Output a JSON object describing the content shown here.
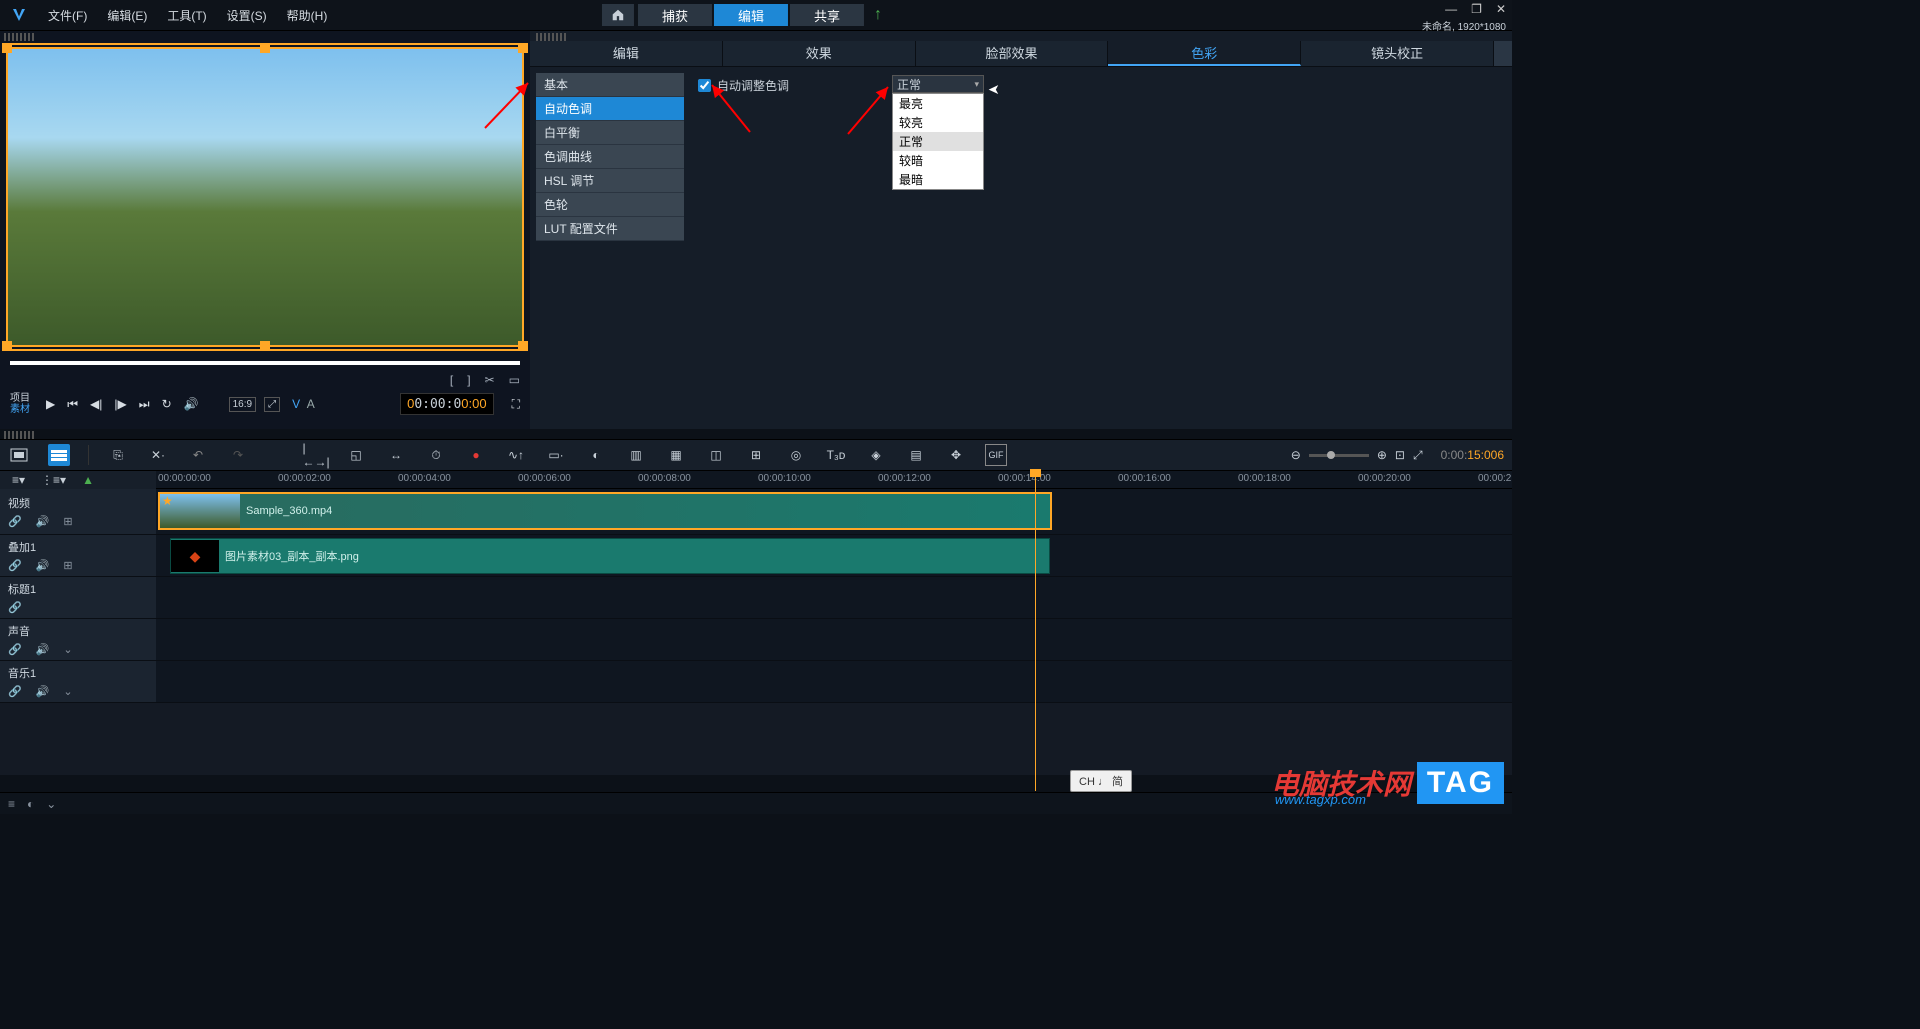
{
  "titlebar": {
    "menus": [
      "文件(F)",
      "编辑(E)",
      "工具(T)",
      "设置(S)",
      "帮助(H)"
    ],
    "tabs": {
      "capture": "捕获",
      "edit": "编辑",
      "share": "共享"
    },
    "project": "未命名, 1920*1080"
  },
  "playback": {
    "project_label": "项目",
    "clip_label": "素材",
    "aspect": "16:9",
    "va": "V A",
    "timecode": "00:00:00:00"
  },
  "editor": {
    "tabs": {
      "edit": "编辑",
      "effect": "效果",
      "face": "脸部效果",
      "color": "色彩",
      "lens": "镜头校正"
    },
    "sidelist": [
      "基本",
      "自动色调",
      "白平衡",
      "色调曲线",
      "HSL 调节",
      "色轮",
      "LUT 配置文件"
    ],
    "auto_adjust_label": "自动调整色调",
    "dropdown": {
      "selected": "正常",
      "options": [
        "最亮",
        "较亮",
        "正常",
        "较暗",
        "最暗"
      ]
    }
  },
  "timeline": {
    "duration": "0:00:15:006",
    "ticks": [
      "00:00:00:00",
      "00:00:02:00",
      "00:00:04:00",
      "00:00:06:00",
      "00:00:08:00",
      "00:00:10:00",
      "00:00:12:00",
      "00:00:14:00",
      "00:00:16:00",
      "00:00:18:00",
      "00:00:20:00",
      "00:00:2"
    ],
    "tracks": {
      "video": "视频",
      "overlay": "叠加1",
      "title": "标题1",
      "voice": "声音",
      "music": "音乐1"
    },
    "clips": {
      "video_name": "Sample_360.mp4",
      "overlay_name": "图片素材03_副本_副本.png"
    }
  },
  "ime": "CH ♩ 简",
  "watermark": {
    "line1": "电脑技术网",
    "line2": "www.tagxp.com",
    "tag": "TAG"
  }
}
